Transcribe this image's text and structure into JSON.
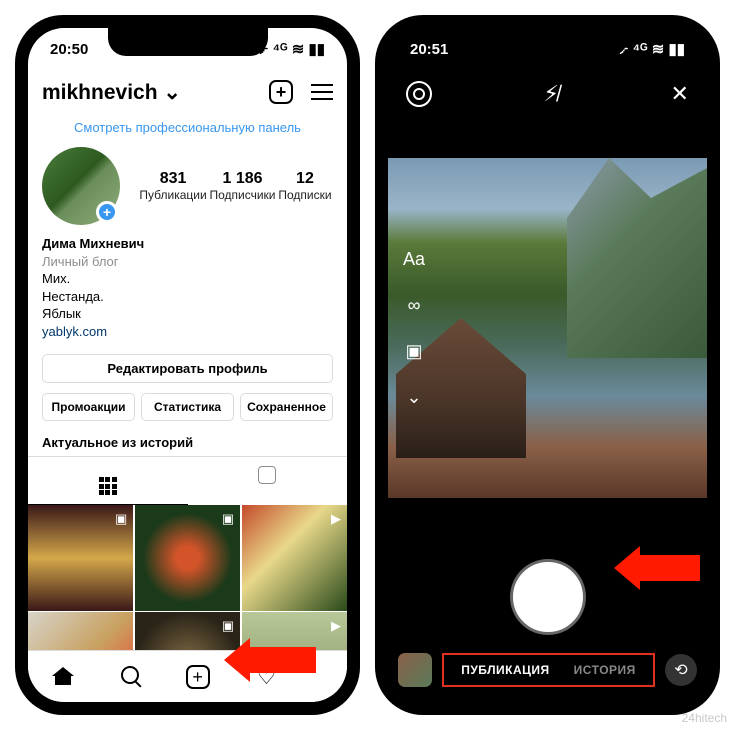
{
  "left_phone": {
    "status": {
      "time": "20:50",
      "indicators": "✈ ⁴ᴳ ≋ ▮▮"
    },
    "header": {
      "username": "mikhnevich"
    },
    "pro_panel": "Смотреть профессиональную панель",
    "stats": {
      "posts_n": "831",
      "posts_l": "Публикации",
      "followers_n": "1 186",
      "followers_l": "Подписчики",
      "following_n": "12",
      "following_l": "Подписки"
    },
    "bio": {
      "name": "Дима Михневич",
      "category": "Личный блог",
      "l1": "Mиx.",
      "l2": "Нестанда.",
      "l3": "Яблык",
      "link": "yablyk.com"
    },
    "edit_btn": "Редактировать профиль",
    "buttons": {
      "promo": "Промоакции",
      "stats": "Статистика",
      "saved": "Сохраненное"
    },
    "highlights": "Актуальное из историй"
  },
  "right_phone": {
    "status": {
      "time": "20:51",
      "indicators": "✈ ⁴ᴳ ≋ ▮▮"
    },
    "tools": {
      "text": "Aa",
      "infinity": "∞",
      "layout": "▣",
      "down": "⌄"
    },
    "modes": {
      "publication": "ПУБЛИКАЦИЯ",
      "story": "ИСТОРИЯ"
    }
  },
  "watermark": "24hitech"
}
